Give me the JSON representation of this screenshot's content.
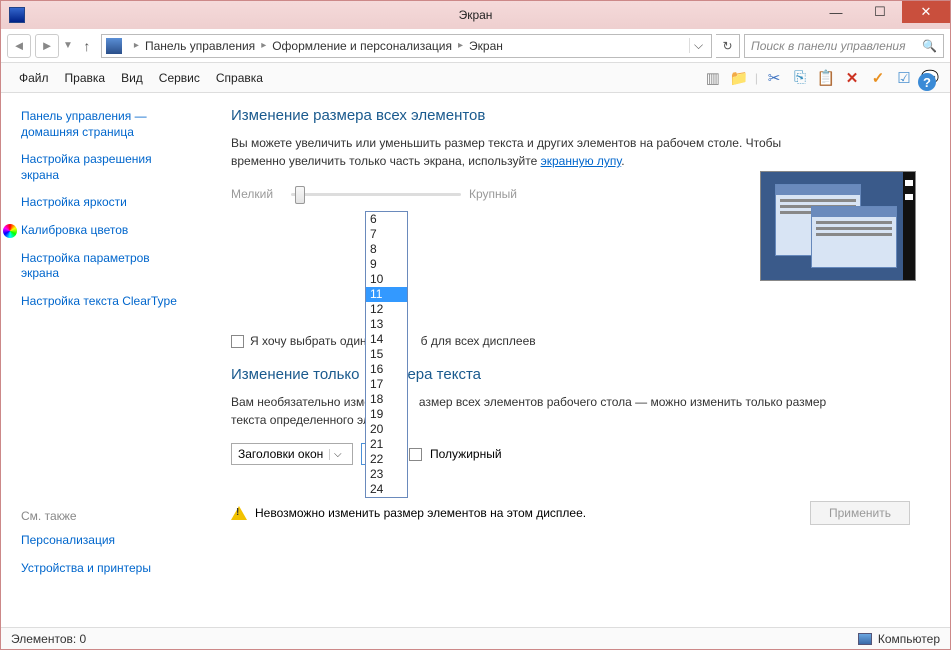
{
  "window": {
    "title": "Экран"
  },
  "breadcrumb": {
    "root": "Панель управления",
    "mid": "Оформление и персонализация",
    "leaf": "Экран"
  },
  "search": {
    "placeholder": "Поиск в панели управления"
  },
  "menu": {
    "file": "Файл",
    "edit": "Правка",
    "view": "Вид",
    "service": "Сервис",
    "help": "Справка"
  },
  "sidebar": {
    "home": "Панель управления — домашняя страница",
    "resolution": "Настройка разрешения экрана",
    "brightness": "Настройка яркости",
    "calibration": "Калибровка цветов",
    "params": "Настройка параметров экрана",
    "cleartype": "Настройка текста ClearType",
    "see_also": "См. также",
    "personalization": "Персонализация",
    "devices": "Устройства и принтеры"
  },
  "main": {
    "h1": "Изменение размера всех элементов",
    "desc1": "Вы можете увеличить или уменьшить размер текста и других элементов на рабочем столе. Чтобы временно увеличить только часть экрана, используйте ",
    "desc_link": "экранную лупу",
    "slider_small": "Мелкий",
    "slider_large": "Крупный",
    "checkbox1": "Я хочу выбрать один",
    "checkbox1b": "б для всех дисплеев",
    "h2a": "Изменение только",
    "h2b": "ера текста",
    "desc2a": "Вам необязательно изме",
    "desc2b": "азмер всех элементов рабочего стола — можно изменить только размер текста определенного эл",
    "combo1": "Заголовки окон",
    "combo2": "11",
    "bold": "Полужирный",
    "warning": "Невозможно изменить размер элементов на этом дисплее.",
    "apply": "Применить"
  },
  "dropdown": {
    "options": [
      "6",
      "7",
      "8",
      "9",
      "10",
      "11",
      "12",
      "13",
      "14",
      "15",
      "16",
      "17",
      "18",
      "19",
      "20",
      "21",
      "22",
      "23",
      "24"
    ],
    "selected": "11"
  },
  "status": {
    "items": "Элементов: 0",
    "computer": "Компьютер"
  }
}
